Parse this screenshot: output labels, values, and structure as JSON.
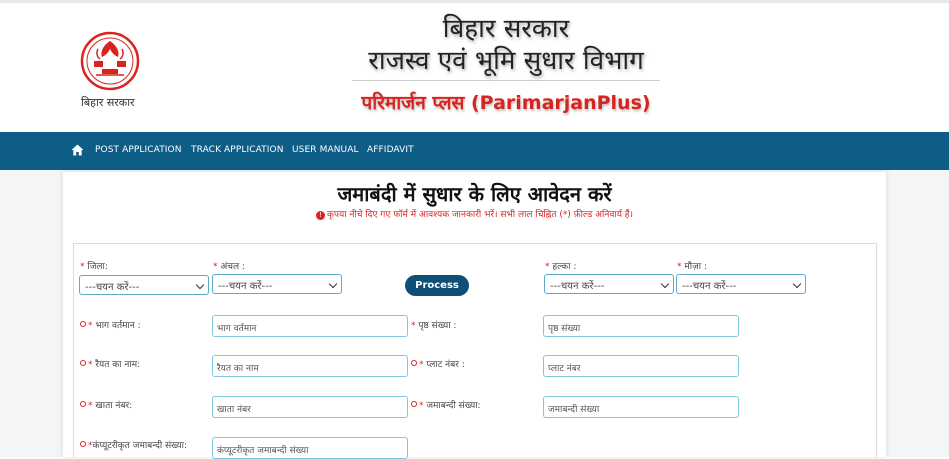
{
  "header": {
    "logo_caption": "बिहार सरकार",
    "title_line1": "बिहार सरकार",
    "title_line2": "राजस्व एवं भूमि सुधार विभाग",
    "portal_name": "परिमार्जन प्लस (ParimarjanPlus)"
  },
  "nav": {
    "home_icon": "home-icon",
    "items": [
      "POST APPLICATION",
      "TRACK APPLICATION",
      "USER MANUAL",
      "AFFIDAVIT"
    ]
  },
  "form": {
    "title": "जमाबंदी में सुधार के लिए आवेदन करें",
    "subtitle": "कृपया नीचे दिए गए फॉर्म में आवश्यक जानकारी भरें। सभी लाल चिह्नित (*) फ़ील्ड अनिवार्य हैं।",
    "info_glyph": "!",
    "required_mark": "*",
    "district": {
      "label": "जिला:",
      "value": "---चयन करें---"
    },
    "circle": {
      "label": "अंचल :",
      "value": "---चयन करें---"
    },
    "process_button": "Process",
    "halka": {
      "label": "हल्का :",
      "value": "---चयन करें---"
    },
    "mauza": {
      "label": "मौज़ा :",
      "value": "---चयन करें---"
    },
    "bhag": {
      "label": "भाग वर्तमान :",
      "placeholder": "भाग वर्तमान"
    },
    "prishth": {
      "label": "पृष्ठ संख्या :",
      "placeholder": "पृष्ठ संख्या"
    },
    "raiyat": {
      "label": "रैयत का नाम:",
      "placeholder": "रैयत का नाम"
    },
    "plot": {
      "label": "प्लाट नंबर :",
      "placeholder": "प्लाट नंबर"
    },
    "khata": {
      "label": "खाता नंबर:",
      "placeholder": "खाता नंबर"
    },
    "jamabandi": {
      "label": "जमाबन्दी संख्या:",
      "placeholder": "जमाबन्दी संख्या"
    },
    "computerized": {
      "label": "कंप्यूटरीकृत जमाबन्दी संख्या:",
      "placeholder": "कंप्यूटरीकृत जमाबन्दी संख्या"
    }
  },
  "colors": {
    "nav_bg": "#0e5d87",
    "button_bg": "#0d4f77",
    "accent_red": "#d9231f",
    "input_border": "#7fc6e0"
  }
}
